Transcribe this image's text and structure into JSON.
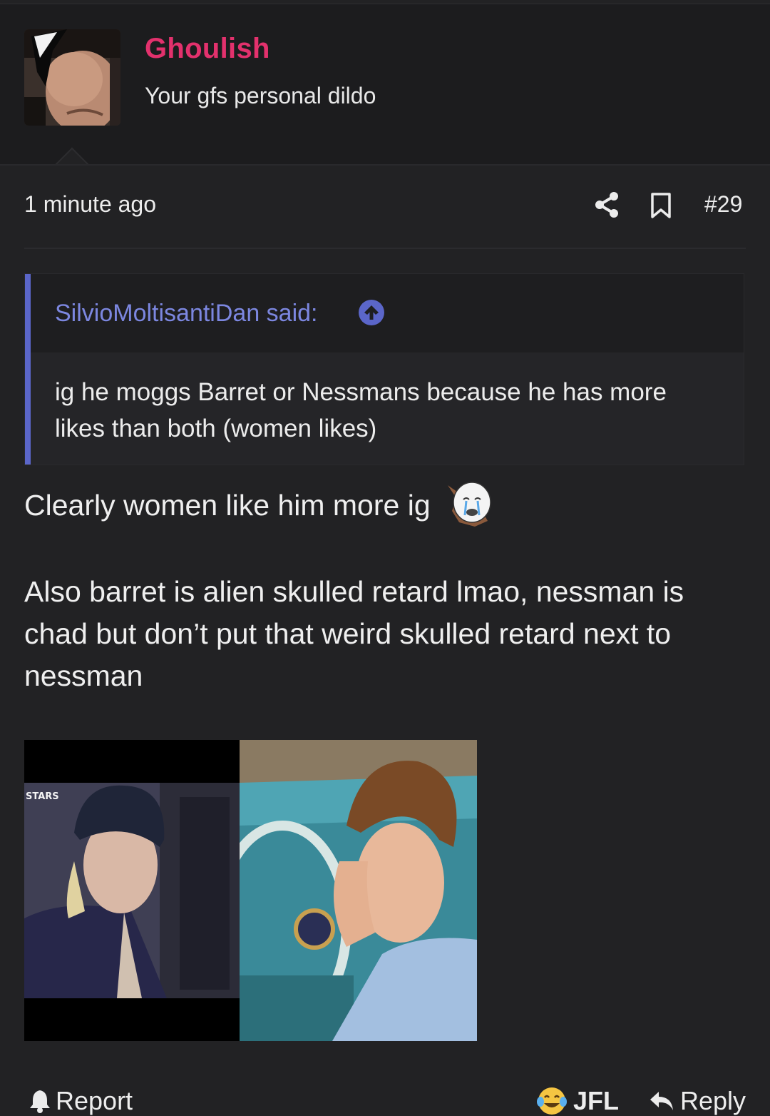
{
  "user": {
    "name": "Ghoulish",
    "title": "Your gfs personal dildo"
  },
  "post": {
    "time": "1 minute ago",
    "number": "#29"
  },
  "quote": {
    "author": "SilvioMoltisantiDan said:",
    "text": "ig he moggs Barret or Nessmans because he has more likes than both (women likes)"
  },
  "message": {
    "line1": "Clearly women like him more ig",
    "para2": "Also barret is alien skulled retard lmao, nessman is chad but don’t put that weird skulled retard next to nessman"
  },
  "image": {
    "left_caption": "STARS"
  },
  "footer": {
    "report": "Report",
    "reaction": "JFL",
    "reply": "Reply"
  },
  "colors": {
    "username": "#e3316d",
    "quote_accent": "#5b66c9",
    "quote_author": "#7c87e0",
    "background": "#222224"
  },
  "icons": [
    "share-icon",
    "bookmark-icon",
    "up-arrow-icon",
    "bell-icon",
    "tears-of-joy-icon",
    "reply-arrow-icon",
    "crying-wojak-sticker"
  ]
}
